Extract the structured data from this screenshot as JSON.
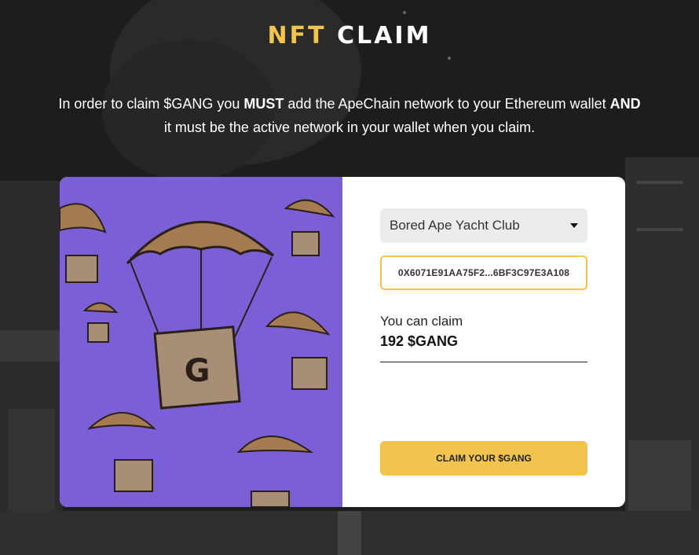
{
  "header": {
    "title_accent": "NFT",
    "title_rest": "CLAIM"
  },
  "intro": {
    "part1": "In order to claim $GANG you ",
    "must": "MUST",
    "part2": " add the ApeChain network to your Ethereum wallet ",
    "and": "AND",
    "part3": " it must be the active network in your wallet when you claim."
  },
  "claim_panel": {
    "collection_selected": "Bored Ape Yacht Club",
    "wallet_address": "0X6071E91AA75F2...6BF3C97E3A108",
    "can_claim_label": "You can claim",
    "claim_amount": "192 $GANG",
    "claim_button_label": "CLAIM YOUR $GANG"
  },
  "colors": {
    "accent": "#f2c44e",
    "art_background": "#7b5fd6",
    "page_background": "#1c1c1c"
  },
  "art": {
    "icon": "parachute-crate-icon",
    "crate_logo": "G"
  }
}
